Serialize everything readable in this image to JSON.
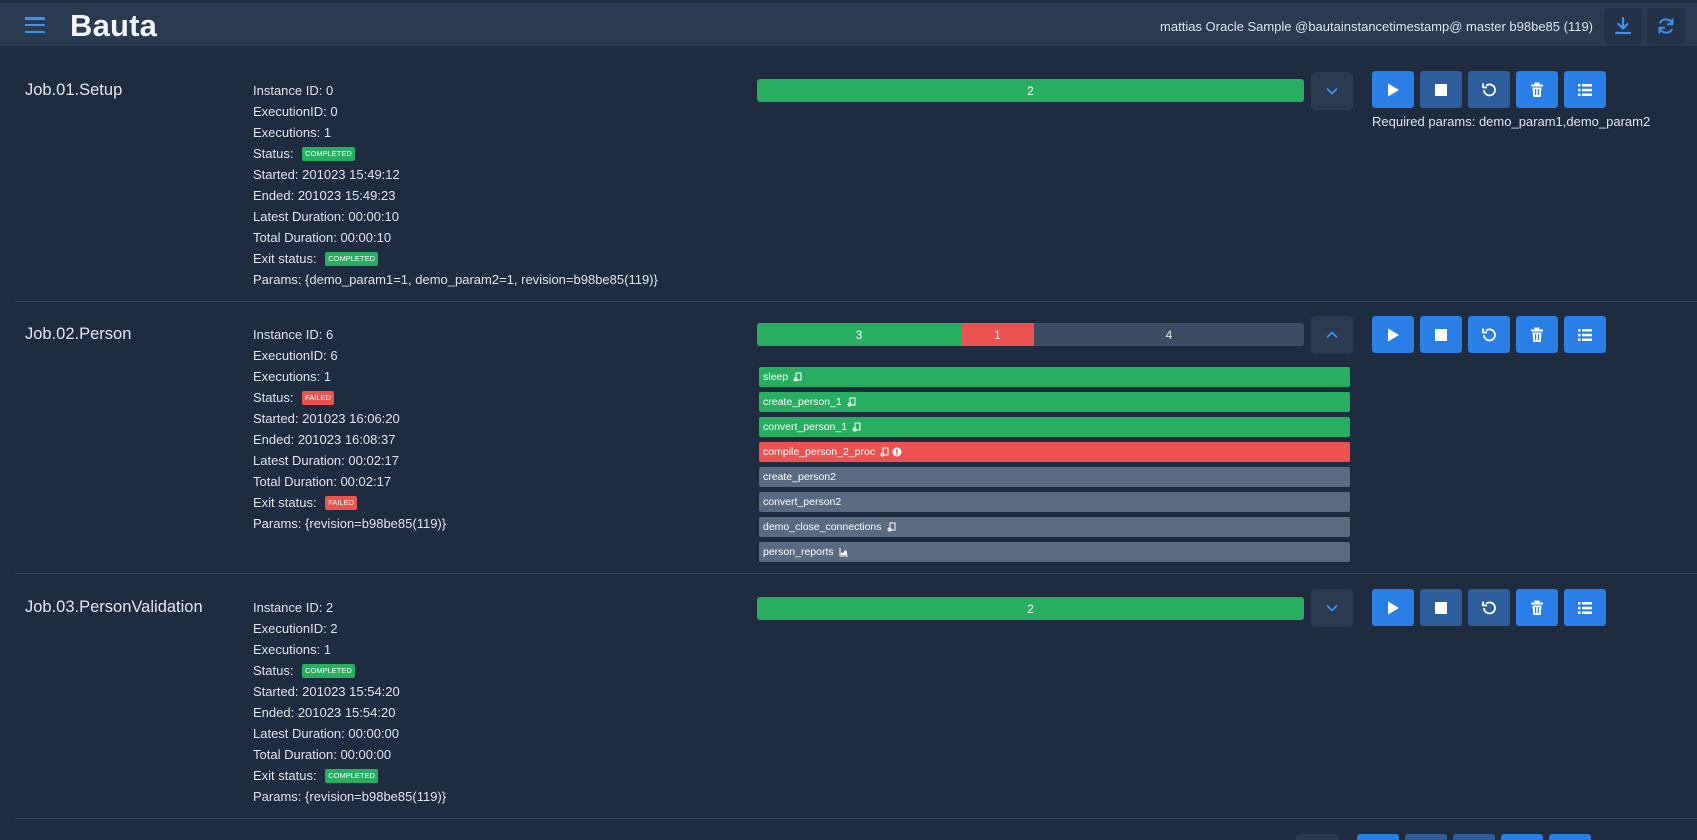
{
  "header": {
    "brand": "Bauta",
    "info": "mattias Oracle Sample @bautainstancetimestamp@ master b98be85 (119)",
    "icons": [
      "menu-icon",
      "download-icon",
      "refresh-icon"
    ]
  },
  "labels": {
    "instance_id": "Instance ID:",
    "execution_id": "ExecutionID:",
    "executions": "Executions:",
    "status": "Status:",
    "started": "Started:",
    "ended": "Ended:",
    "latest_duration": "Latest Duration:",
    "total_duration": "Total Duration:",
    "exit_status": "Exit status:",
    "params": "Params:"
  },
  "jobs": [
    {
      "title": "Job.01.Setup",
      "instance_id": "0",
      "execution_id": "0",
      "executions": "1",
      "status": "COMPLETED",
      "started": "201023 15:49:12",
      "ended": "201023 15:49:23",
      "latest_duration": "00:00:10",
      "total_duration": "00:00:10",
      "exit_status": "COMPLETED",
      "params": "{demo_param1=1, demo_param2=1, revision=b98be85(119)}",
      "progress": [
        {
          "label": "2",
          "value": 2,
          "color": "green"
        }
      ],
      "required_params": "Required params: demo_param1,demo_param2",
      "expanded": false
    },
    {
      "title": "Job.02.Person",
      "instance_id": "6",
      "execution_id": "6",
      "executions": "1",
      "status": "FAILED",
      "started": "201023 16:06:20",
      "ended": "201023 16:08:37",
      "latest_duration": "00:02:17",
      "total_duration": "00:02:17",
      "exit_status": "FAILED",
      "params": "{revision=b98be85(119)}",
      "progress": [
        {
          "label": "3",
          "value": 3,
          "color": "green"
        },
        {
          "label": "1",
          "value": 1,
          "color": "red"
        },
        {
          "label": "4",
          "value": 4,
          "color": "grey"
        }
      ],
      "expanded": true,
      "steps": [
        {
          "name": "sleep",
          "color": "green",
          "icons": [
            "log-icon"
          ]
        },
        {
          "name": "create_person_1",
          "color": "green",
          "icons": [
            "log-icon"
          ]
        },
        {
          "name": "convert_person_1",
          "color": "green",
          "icons": [
            "log-icon"
          ]
        },
        {
          "name": "compile_person_2_proc",
          "color": "red",
          "icons": [
            "log-icon",
            "error-icon"
          ]
        },
        {
          "name": "create_person2",
          "color": "grey",
          "icons": []
        },
        {
          "name": "convert_person2",
          "color": "grey",
          "icons": []
        },
        {
          "name": "demo_close_connections",
          "color": "grey",
          "icons": [
            "log-icon"
          ]
        },
        {
          "name": "person_reports",
          "color": "grey",
          "icons": [
            "chart-icon"
          ]
        }
      ]
    },
    {
      "title": "Job.03.PersonValidation",
      "instance_id": "2",
      "execution_id": "2",
      "executions": "1",
      "status": "COMPLETED",
      "started": "201023 15:54:20",
      "ended": "201023 15:54:20",
      "latest_duration": "00:00:00",
      "total_duration": "00:00:00",
      "exit_status": "COMPLETED",
      "params": "{revision=b98be85(119)}",
      "progress": [
        {
          "label": "2",
          "value": 2,
          "color": "green"
        }
      ],
      "expanded": false
    }
  ],
  "colors": {
    "background": "#1f2b3e",
    "header": "#2a3a50",
    "completed": "#27ae60",
    "failed": "#eb5353",
    "primary": "#2a7fe6"
  }
}
